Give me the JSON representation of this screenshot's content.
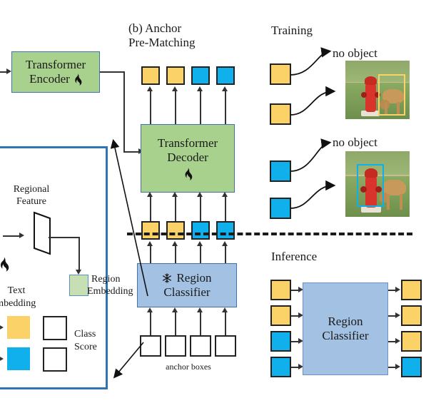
{
  "figure": {
    "panel_b_title_line1": "(b) Anchor",
    "panel_b_title_line2": "Pre-Matching",
    "training_title": "Training",
    "inference_title": "Inference",
    "anchor_boxes_label": "anchor boxes"
  },
  "colors": {
    "yellow_token": "#FBD267",
    "blue_token": "#0FB0EC",
    "green_block": "#A9D18E",
    "blue_block": "#A3C2E3",
    "green_embedding": "#C6E0B4",
    "orange_panel_border": "#FFC000",
    "blue_panel_border": "#2E75B6"
  },
  "left_panel": {
    "encoder_label_line1": "Transformer",
    "encoder_label_line2": "Encoder",
    "encoder_icon": "flame-icon",
    "regional_feature_line1": "Regional",
    "regional_feature_line2": "Feature",
    "flame_icon": "flame-icon",
    "text_embedding_line1": "Text",
    "text_embedding_line2": "Embedding",
    "region_embedding_line1": "Region",
    "region_embedding_line2": "Embedding",
    "class_score_line1": "Class",
    "class_score_line2": "Score"
  },
  "pipeline": {
    "decoder_label_line1": "Transformer",
    "decoder_label_line2": "Decoder",
    "decoder_icon": "flame-icon",
    "classifier_label_line1": "Region",
    "classifier_label_line2": "Classifier",
    "classifier_icon": "snowflake-icon",
    "top_tokens": [
      "yellow",
      "yellow",
      "blue",
      "blue"
    ],
    "mid_tokens": [
      "yellow",
      "yellow",
      "blue",
      "blue"
    ],
    "anchor_tokens": [
      "white",
      "white",
      "white",
      "white"
    ]
  },
  "training": {
    "row1": {
      "tokens": [
        "yellow",
        "yellow"
      ],
      "no_object_label": "no object",
      "bbox_color": "#FBD267",
      "bbox_target": "dog"
    },
    "row2": {
      "tokens": [
        "blue",
        "blue"
      ],
      "no_object_label": "no object",
      "bbox_color": "#0FB0EC",
      "bbox_target": "fire-hydrant"
    }
  },
  "inference": {
    "classifier_label_line1": "Region",
    "classifier_label_line2": "Classifier",
    "inputs": [
      "yellow",
      "yellow",
      "blue",
      "blue"
    ],
    "outputs": [
      "yellow",
      "yellow",
      "yellow",
      "blue"
    ]
  }
}
